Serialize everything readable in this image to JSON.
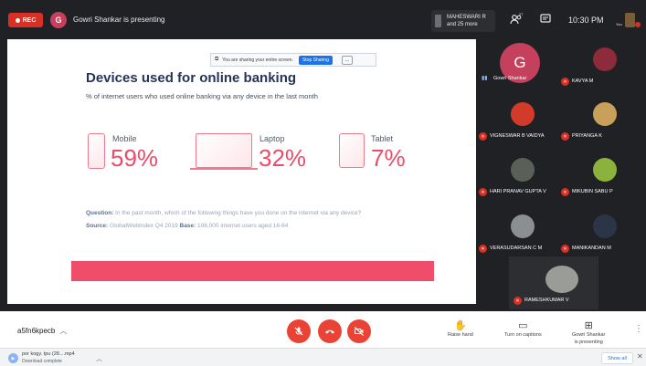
{
  "topbar": {
    "rec_label": "REC",
    "presenter_initial": "G",
    "presenting_text": "Gowri Shankar is presenting",
    "host_line1": "MAHESWARI R",
    "host_line2": "and 25 more",
    "people_badge": "27",
    "time": "10:30 PM",
    "you_label": "You"
  },
  "share_bar": {
    "text": "You are sharing your entire screen.",
    "stop_label": "Stop Sharing",
    "hide_label": "..."
  },
  "slide": {
    "title": "Devices used for online banking",
    "subtitle": "% of internet users who used online banking via any device in the last month",
    "devices": [
      {
        "name": "Mobile",
        "pct": "59%"
      },
      {
        "name": "Laptop",
        "pct": "32%"
      },
      {
        "name": "Tablet",
        "pct": "7%"
      }
    ],
    "question_label": "Question:",
    "question_text": " In the past month, which of the following things have you done on the internet via any device?",
    "source_label": "Source:",
    "source_text": " GlobalWebIndex Q4 2019 ",
    "base_label": "Base:",
    "base_text": " 108,000 internet users aged 16-64",
    "accent": "#ea4c6a"
  },
  "participants": {
    "presenter_initial": "G",
    "presenter_name": "Gowri Shankar",
    "tiles": [
      {
        "name": "KAVYA M",
        "color": "#8e2b3a"
      },
      {
        "name": "VIGNESWAR B VAIDYA",
        "color": "#d23a2a"
      },
      {
        "name": "PRIYANGA K",
        "color": "#c9a05a"
      },
      {
        "name": "HARI PRANAV GUPTA V",
        "color": "#5a5f58"
      },
      {
        "name": "MIKUBIN SABU P",
        "color": "#8ab23c"
      },
      {
        "name": "VERASUDARSAN C M",
        "color": "#8c8f91"
      },
      {
        "name": "MANIKANDAN M",
        "color": "#2c3548"
      },
      {
        "name": "RAMESHKUMAR V",
        "color": "#9a9c98"
      }
    ]
  },
  "controls": {
    "meeting_code": "a5fn6kpecb",
    "raise_hand": "Raise hand",
    "captions": "Turn on captions",
    "presenting_line1": "Gowri Shankar",
    "presenting_line2": "is presenting"
  },
  "downloads": {
    "file_name": "por kogy. tpu (28....mp4",
    "file_status": "Download complete",
    "show_all": "Show all"
  }
}
